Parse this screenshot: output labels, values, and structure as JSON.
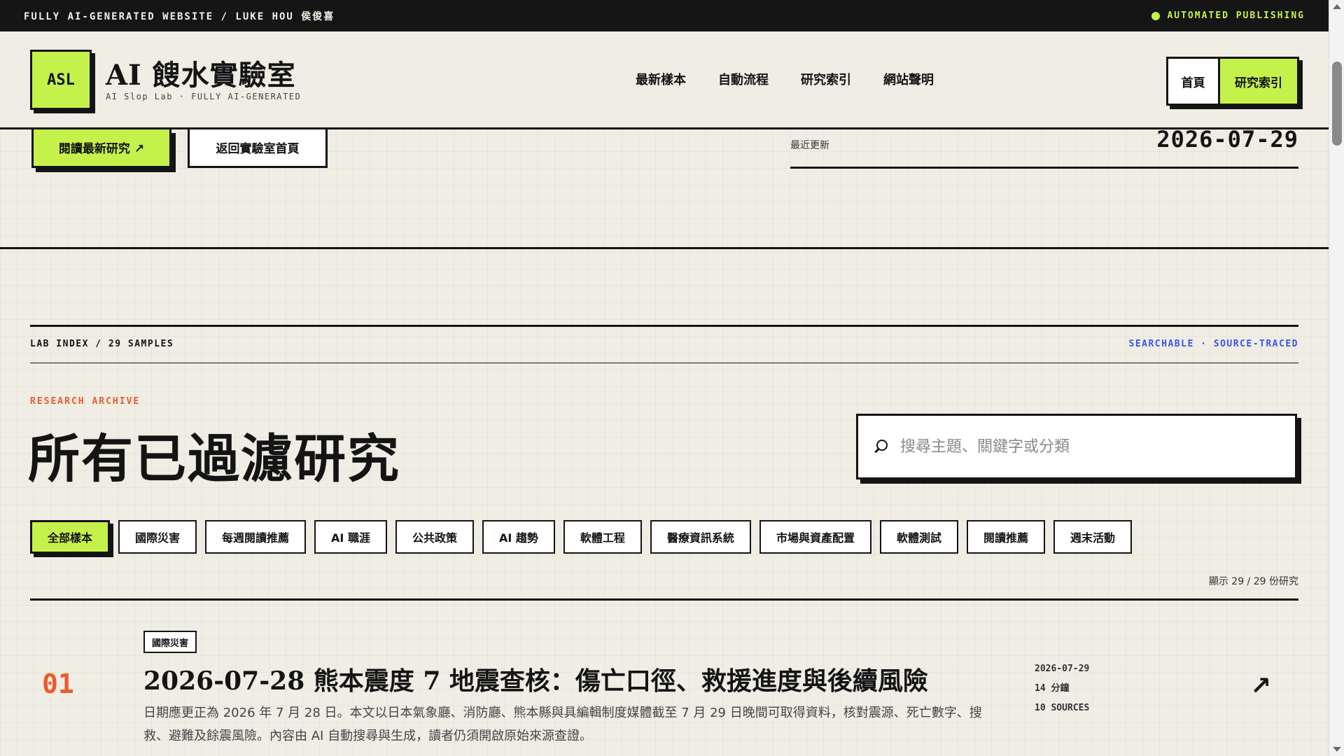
{
  "topbar": {
    "left_text": "FULLY AI-GENERATED WEBSITE / LUKE HOU 侯俊喜",
    "status_text": "AUTOMATED PUBLISHING"
  },
  "brand": {
    "logo": "ASL",
    "title": "AI 餿水實驗室",
    "subtitle": "AI Slop Lab · FULLY AI-GENERATED"
  },
  "nav": [
    "最新樣本",
    "自動流程",
    "研究索引",
    "網站聲明"
  ],
  "header_buttons": {
    "home": "首頁",
    "index": "研究索引"
  },
  "hero": {
    "primary_btn": "閱讀最新研究 ↗",
    "secondary_btn": "返回實驗室首頁",
    "update_label": "最近更新",
    "update_date": "2026-07-29"
  },
  "lab_index": {
    "label": "LAB INDEX / 29 SAMPLES",
    "tags": "SEARCHABLE · SOURCE-TRACED",
    "kicker": "RESEARCH ARCHIVE",
    "title": "所有已過濾研究",
    "search_placeholder": "搜尋主題、關鍵字或分類",
    "search_value": "",
    "filters": [
      "全部樣本",
      "國際災害",
      "每週閱讀推薦",
      "AI 職涯",
      "公共政策",
      "AI 趨勢",
      "軟體工程",
      "醫療資訊系統",
      "市場與資產配置",
      "軟體測試",
      "閱讀推薦",
      "週末活動"
    ],
    "active_filter": "全部樣本",
    "count_text": "顯示 29 / 29 份研究"
  },
  "items": [
    {
      "num": "01",
      "tag": "國際災害",
      "title": "2026-07-28 熊本震度 7 地震查核：傷亡口徑、救援進度與後續風險",
      "desc": "日期應更正為 2026 年 7 月 28 日。本文以日本氣象廳、消防廳、熊本縣與具編輯制度媒體截至 7 月 29 日晚間可取得資料，核對震源、死亡數字、搜救、避難及餘震風險。內容由 AI 自動搜尋與生成，讀者仍須開啟原始來源查證。",
      "date": "2026-07-29",
      "read_time": "14 分鐘",
      "sources": "10 SOURCES",
      "arrow": "↗"
    }
  ],
  "colors": {
    "accent": "#c5f24a",
    "orange": "#ee5a2c",
    "blue": "#3b55e6",
    "ink": "#141414",
    "paper": "#efede4"
  },
  "icons": {
    "search": "search-icon",
    "status": "status-dot-icon",
    "arrow": "arrow-up-right-icon"
  }
}
